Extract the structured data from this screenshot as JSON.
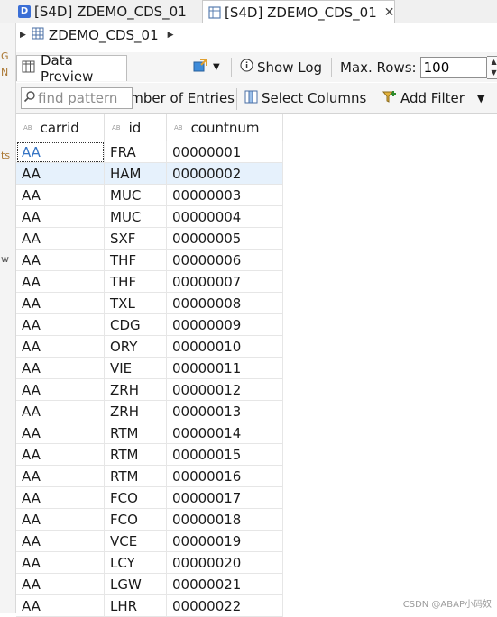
{
  "tabs": [
    {
      "label": "[S4D] ZDEMO_CDS_01",
      "icon": "cds-document-icon",
      "active": false
    },
    {
      "label": "[S4D] ZDEMO_CDS_01",
      "icon": "data-preview-icon",
      "active": true,
      "close": "✕"
    }
  ],
  "breadcrumb": {
    "label": "ZDEMO_CDS_01"
  },
  "view": {
    "tab_label": "Data Preview",
    "show_log": "Show Log",
    "max_rows_label": "Max. Rows:",
    "max_rows_value": "100"
  },
  "filterbar": {
    "search_placeholder": "find pattern",
    "entries_label": "Number of Entries",
    "select_columns": "Select Columns",
    "add_filter": "Add Filter"
  },
  "table": {
    "columns": [
      "carrid",
      "id",
      "countnum"
    ],
    "column_type_badge": "AB",
    "rows": [
      [
        "AA",
        "FRA",
        "00000001"
      ],
      [
        "AA",
        "HAM",
        "00000002"
      ],
      [
        "AA",
        "MUC",
        "00000003"
      ],
      [
        "AA",
        "MUC",
        "00000004"
      ],
      [
        "AA",
        "SXF",
        "00000005"
      ],
      [
        "AA",
        "THF",
        "00000006"
      ],
      [
        "AA",
        "THF",
        "00000007"
      ],
      [
        "AA",
        "TXL",
        "00000008"
      ],
      [
        "AA",
        "CDG",
        "00000009"
      ],
      [
        "AA",
        "ORY",
        "00000010"
      ],
      [
        "AA",
        "VIE",
        "00000011"
      ],
      [
        "AA",
        "ZRH",
        "00000012"
      ],
      [
        "AA",
        "ZRH",
        "00000013"
      ],
      [
        "AA",
        "RTM",
        "00000014"
      ],
      [
        "AA",
        "RTM",
        "00000015"
      ],
      [
        "AA",
        "RTM",
        "00000016"
      ],
      [
        "AA",
        "FCO",
        "00000017"
      ],
      [
        "AA",
        "FCO",
        "00000018"
      ],
      [
        "AA",
        "VCE",
        "00000019"
      ],
      [
        "AA",
        "LCY",
        "00000020"
      ],
      [
        "AA",
        "LGW",
        "00000021"
      ],
      [
        "AA",
        "LHR",
        "00000022"
      ]
    ]
  },
  "watermark": "CSDN @ABAP小码奴",
  "colors": {
    "accent": "#3574c4",
    "selection": "#e6f1fc"
  }
}
